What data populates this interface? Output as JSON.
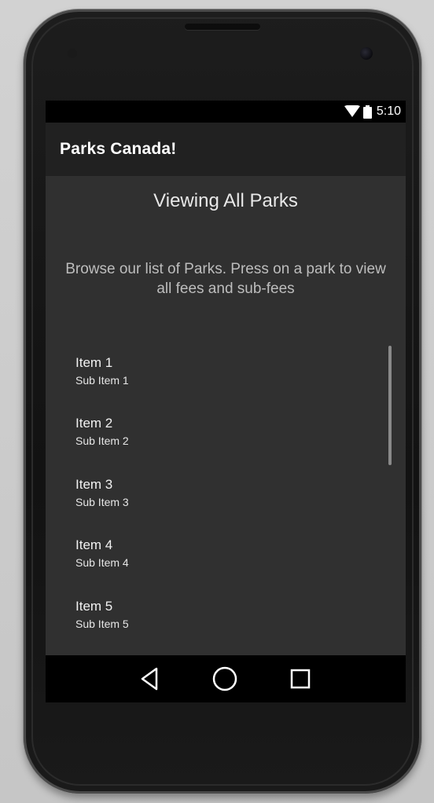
{
  "status_bar": {
    "time": "5:10",
    "icons": [
      "wifi-icon",
      "battery-icon"
    ]
  },
  "app_bar": {
    "title": "Parks Canada!"
  },
  "main": {
    "heading": "Viewing All Parks",
    "description": "Browse our list of Parks. Press on a park to view all fees and sub-fees",
    "list": [
      {
        "title": "Item 1",
        "subtitle": "Sub Item 1"
      },
      {
        "title": "Item 2",
        "subtitle": "Sub Item 2"
      },
      {
        "title": "Item 3",
        "subtitle": "Sub Item 3"
      },
      {
        "title": "Item 4",
        "subtitle": "Sub Item 4"
      },
      {
        "title": "Item 5",
        "subtitle": "Sub Item 5"
      }
    ]
  },
  "nav_bar": {
    "icons": [
      "back-icon",
      "home-icon",
      "recent-apps-icon"
    ]
  },
  "colors": {
    "screen_background": "#303030",
    "app_bar": "#212121",
    "status_bar": "#000000",
    "nav_bar": "#000000"
  }
}
